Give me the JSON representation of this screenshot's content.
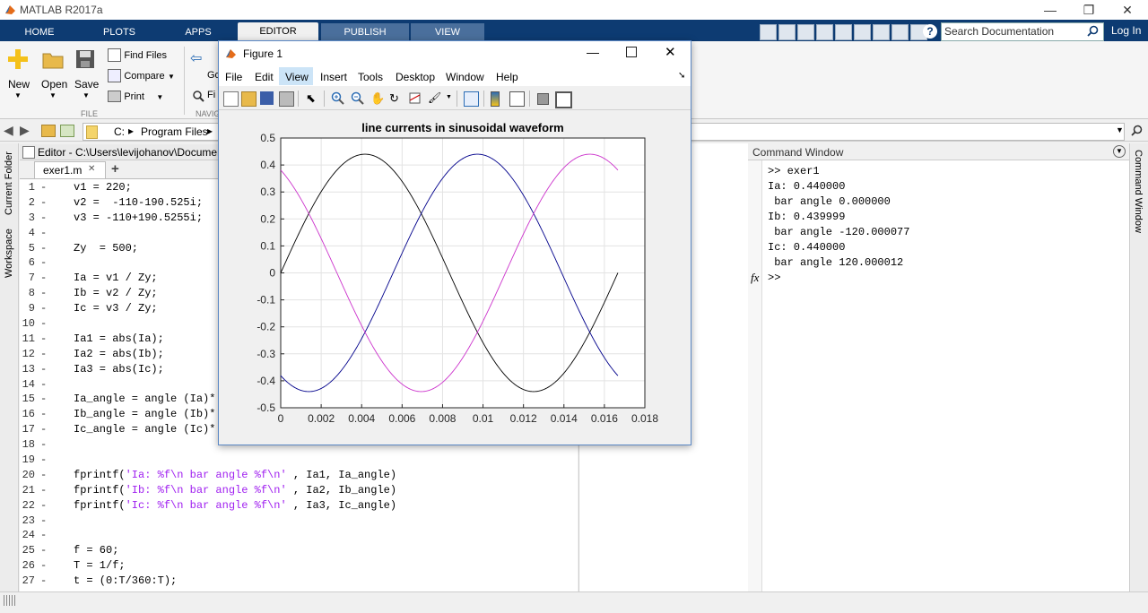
{
  "app": {
    "title": "MATLAB R2017a"
  },
  "ribbon_tabs": [
    "HOME",
    "PLOTS",
    "APPS",
    "EDITOR",
    "PUBLISH",
    "VIEW"
  ],
  "search": {
    "placeholder": "Search Documentation"
  },
  "login": "Log In",
  "ribbon": {
    "new": "New",
    "open": "Open",
    "save": "Save",
    "find_files": "Find Files",
    "compare": "Compare",
    "print": "Print",
    "file_section": "FILE",
    "navigate_section": "NAVIG",
    "goto": "Go",
    "find": "Fi"
  },
  "address": {
    "drive": "C:",
    "sep": "▸",
    "folder": "Program Files",
    "arrow": "▸"
  },
  "left_tabs": {
    "current_folder": "Current Folder",
    "workspace": "Workspace"
  },
  "editor": {
    "title": "Editor - C:\\Users\\levijohanov\\Document",
    "file_tab": "exer1.m",
    "close": "✕",
    "add": "+",
    "lines": [
      {
        "n": "1",
        "t": "v1 = 220;"
      },
      {
        "n": "2",
        "t": "v2 =  -110-190.525i;"
      },
      {
        "n": "3",
        "t": "v3 = -110+190.5255i;"
      },
      {
        "n": "4",
        "t": ""
      },
      {
        "n": "5",
        "t": "Zy  = 500;"
      },
      {
        "n": "6",
        "t": ""
      },
      {
        "n": "7",
        "t": "Ia = v1 / Zy;"
      },
      {
        "n": "8",
        "t": "Ib = v2 / Zy;"
      },
      {
        "n": "9",
        "t": "Ic = v3 / Zy;"
      },
      {
        "n": "10",
        "t": ""
      },
      {
        "n": "11",
        "t": "Ia1 = abs(Ia);"
      },
      {
        "n": "12",
        "t": "Ia2 = abs(Ib);"
      },
      {
        "n": "13",
        "t": "Ia3 = abs(Ic);"
      },
      {
        "n": "14",
        "t": ""
      },
      {
        "n": "15",
        "t": "Ia_angle = angle (Ia)*"
      },
      {
        "n": "16",
        "t": "Ib_angle = angle (Ib)*"
      },
      {
        "n": "17",
        "t": "Ic_angle = angle (Ic)*"
      },
      {
        "n": "18",
        "t": ""
      },
      {
        "n": "19",
        "t": ""
      },
      {
        "n": "20",
        "t": "fprintf(",
        "s": "'Ia: %f\\n bar angle %f\\n'",
        "r": " , Ia1, Ia_angle)"
      },
      {
        "n": "21",
        "t": "fprintf(",
        "s": "'Ib: %f\\n bar angle %f\\n'",
        "r": " , Ia2, Ib_angle)"
      },
      {
        "n": "22",
        "t": "fprintf(",
        "s": "'Ic: %f\\n bar angle %f\\n'",
        "r": " , Ia3, Ic_angle)"
      },
      {
        "n": "23",
        "t": ""
      },
      {
        "n": "24",
        "t": ""
      },
      {
        "n": "25",
        "t": "f = 60;"
      },
      {
        "n": "26",
        "t": "T = 1/f;"
      },
      {
        "n": "27",
        "t": "t = (0:T/360:T);"
      }
    ]
  },
  "command_window": {
    "title": "Command Window",
    "side_label": "Command Window",
    "fx": "fx",
    "lines": [
      ">> exer1",
      "Ia: 0.440000",
      " bar angle 0.000000",
      "Ib: 0.439999",
      " bar angle -120.000077",
      "Ic: 0.440000",
      " bar angle 120.000012",
      ">>"
    ]
  },
  "figure": {
    "title": "Figure 1",
    "menu": [
      "File",
      "Edit",
      "View",
      "Insert",
      "Tools",
      "Desktop",
      "Window",
      "Help"
    ],
    "active_menu": "View"
  },
  "chart_data": {
    "type": "line",
    "title": "line currents in sinusoidal waveform",
    "xlabel": "",
    "ylabel": "",
    "xlim": [
      0,
      0.018
    ],
    "ylim": [
      -0.5,
      0.5
    ],
    "xticks": [
      "0",
      "0.002",
      "0.004",
      "0.006",
      "0.008",
      "0.01",
      "0.012",
      "0.014",
      "0.016",
      "0.018"
    ],
    "yticks": [
      "0.5",
      "0.4",
      "0.3",
      "0.2",
      "0.1",
      "0",
      "-0.1",
      "-0.2",
      "-0.3",
      "-0.4",
      "-0.5"
    ],
    "grid": true,
    "frequency_hz": 60,
    "x_end": 0.016667,
    "series": [
      {
        "amplitude": 0.44,
        "phase_deg": 0,
        "color": "#000000"
      },
      {
        "amplitude": 0.44,
        "phase_deg": -120,
        "color": "#00008b"
      },
      {
        "amplitude": 0.44,
        "phase_deg": 120,
        "color": "#cc33cc"
      }
    ]
  },
  "colors": {
    "tabbar": "#0d3b72",
    "accent": "#5b88c5",
    "string": "#a020f0"
  }
}
